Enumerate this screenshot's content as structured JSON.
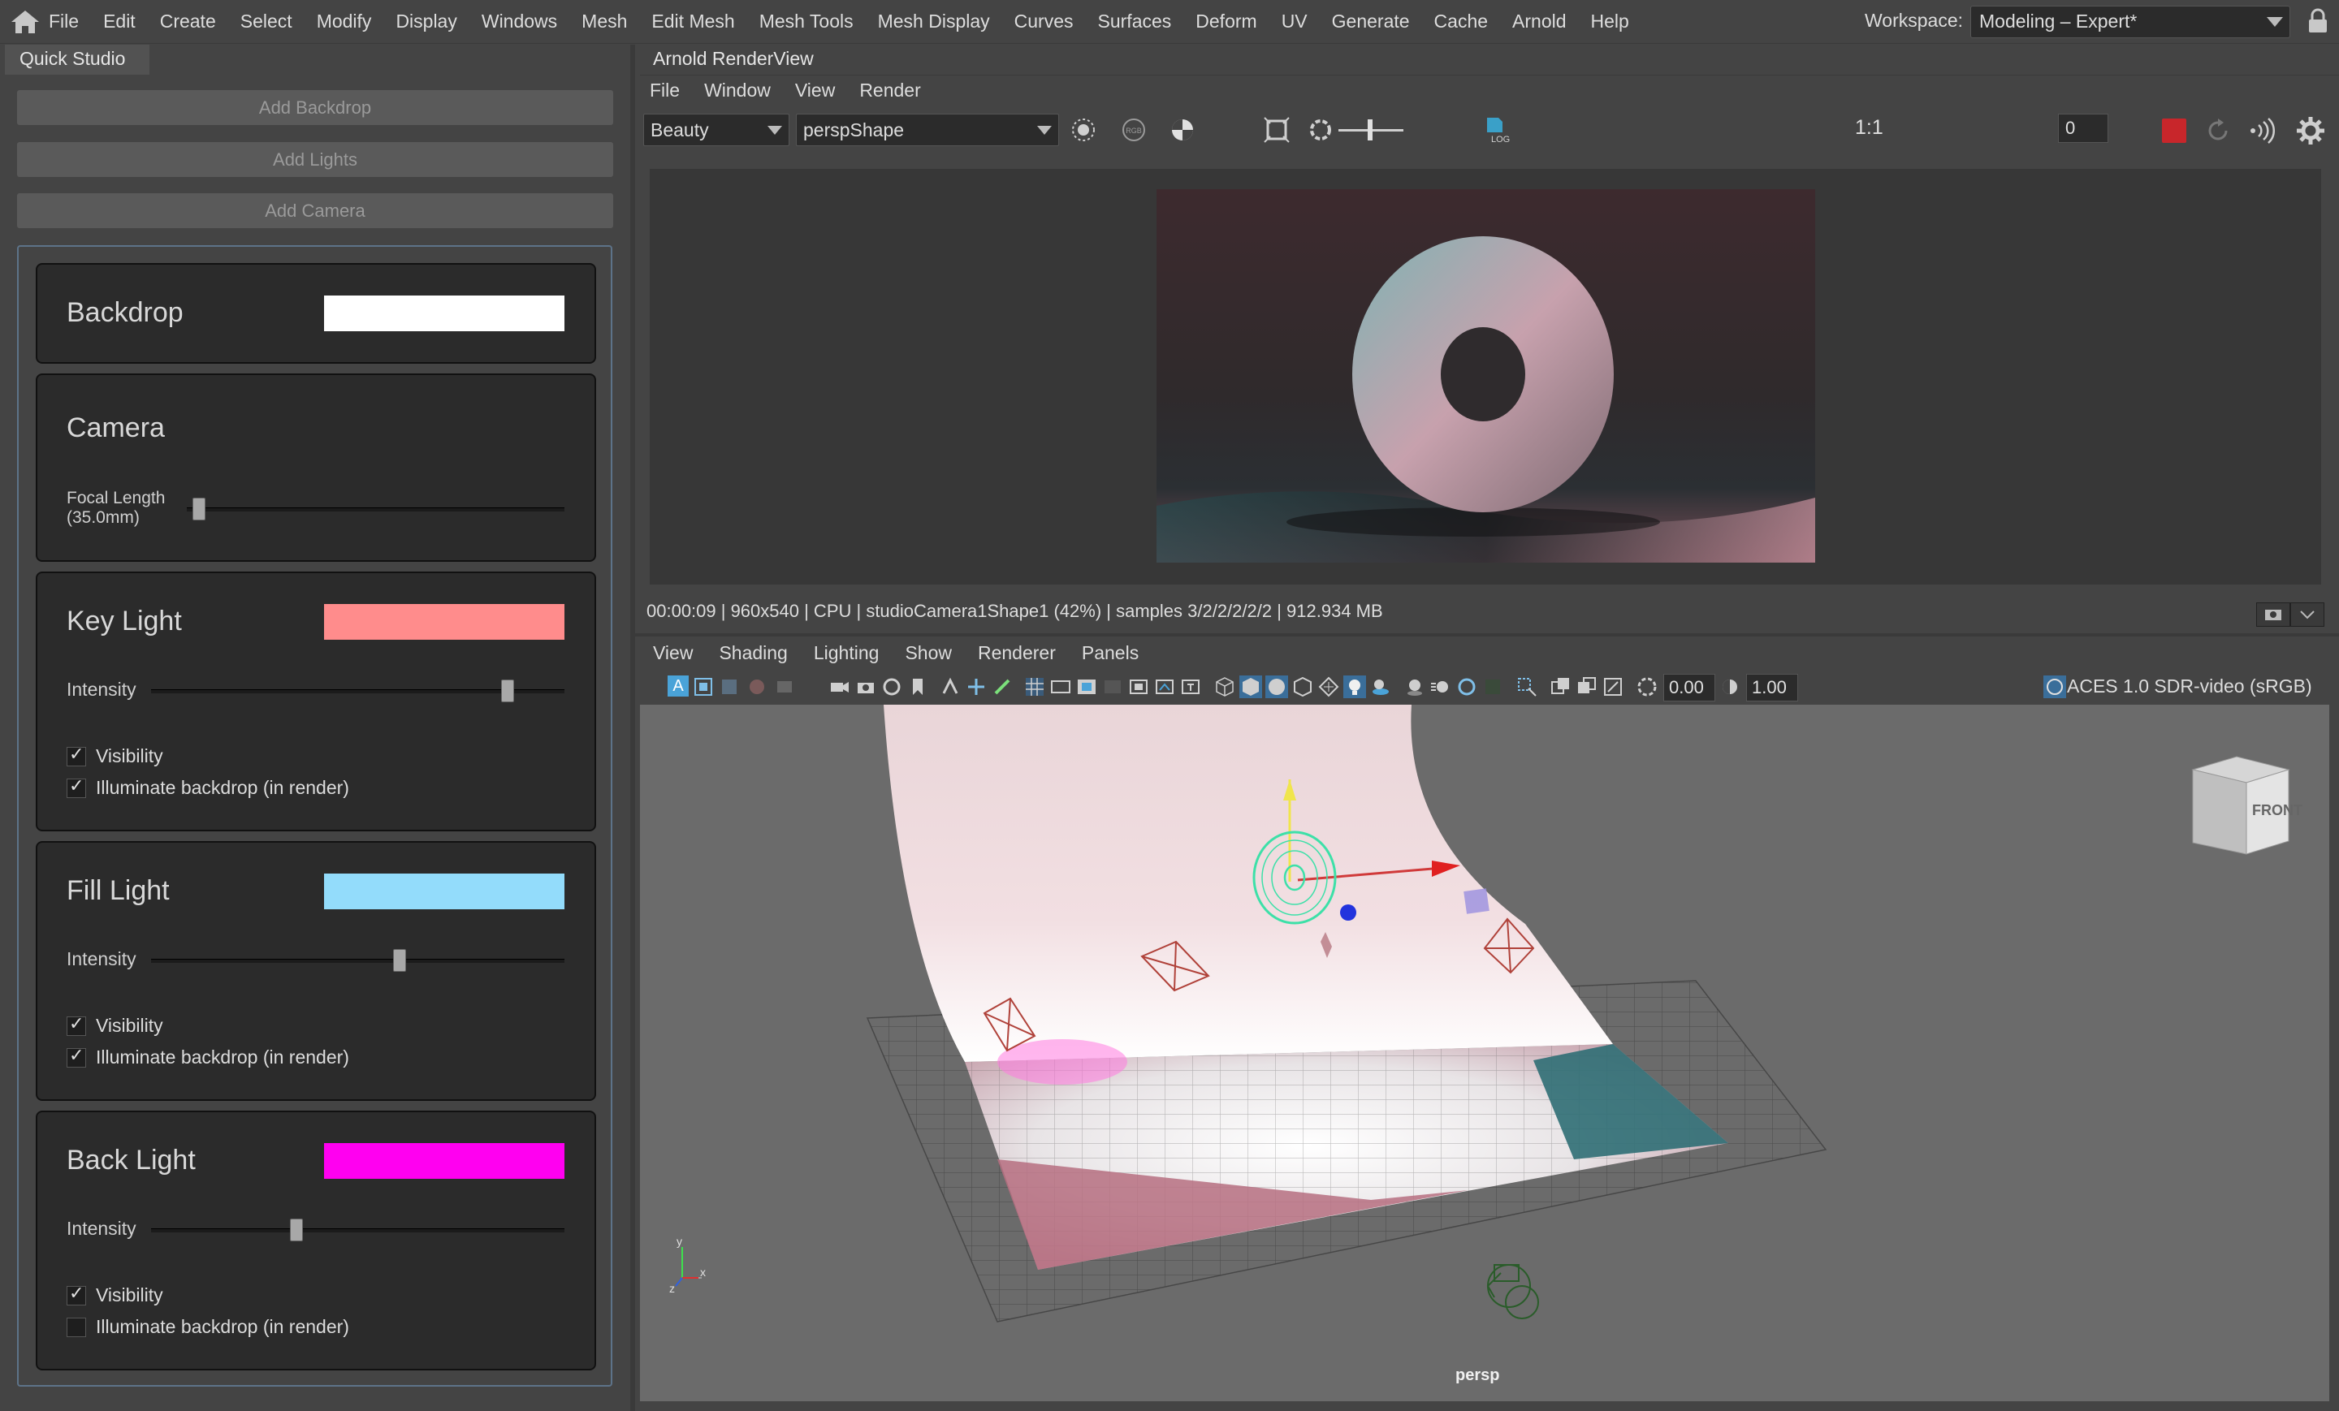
{
  "menubar": {
    "items": [
      "File",
      "Edit",
      "Create",
      "Select",
      "Modify",
      "Display",
      "Windows",
      "Mesh",
      "Edit Mesh",
      "Mesh Tools",
      "Mesh Display",
      "Curves",
      "Surfaces",
      "Deform",
      "UV",
      "Generate",
      "Cache",
      "Arnold",
      "Help"
    ],
    "workspace_label": "Workspace:",
    "workspace_value": "Modeling – Expert*"
  },
  "quick_studio": {
    "tab_label": "Quick Studio",
    "buttons": [
      "Add Backdrop",
      "Add Lights",
      "Add Camera"
    ],
    "backdrop": {
      "title": "Backdrop",
      "color": "#ffffff"
    },
    "camera": {
      "title": "Camera",
      "focal_label_line1": "Focal Length",
      "focal_label_line2": "(35.0mm)",
      "focal_value": 0.03
    },
    "key_light": {
      "title": "Key Light",
      "color": "#ff8c8c",
      "intensity_label": "Intensity",
      "intensity": 0.86,
      "visibility_label": "Visibility",
      "visibility": true,
      "illuminate_label": "Illuminate backdrop (in render)",
      "illuminate": true
    },
    "fill_light": {
      "title": "Fill Light",
      "color": "#93dcfb",
      "intensity_label": "Intensity",
      "intensity": 0.6,
      "visibility_label": "Visibility",
      "visibility": true,
      "illuminate_label": "Illuminate backdrop (in render)",
      "illuminate": true
    },
    "back_light": {
      "title": "Back Light",
      "color": "#ff00f0",
      "intensity_label": "Intensity",
      "intensity": 0.35,
      "visibility_label": "Visibility",
      "visibility": true,
      "illuminate_label": "Illuminate backdrop (in render)",
      "illuminate": false
    }
  },
  "render_view": {
    "tab_label": "Arnold RenderView",
    "menu": [
      "File",
      "Window",
      "View",
      "Render"
    ],
    "aov_value": "Beauty",
    "camera_value": "perspShape",
    "ratio_label": "1:1",
    "exposure_value": "0",
    "log_label": "LOG",
    "rgb_label": "RGB",
    "status": "00:00:09 |  960x540 | CPU | studioCamera1Shape1 (42%) | samples 3/2/2/2/2/2 | 912.934 MB"
  },
  "viewport": {
    "menu": [
      "View",
      "Shading",
      "Lighting",
      "Show",
      "Renderer",
      "Panels"
    ],
    "exposure": "0.00",
    "gamma": "1.00",
    "color_space": "ACES 1.0 SDR-video (sRGB)",
    "camera_label": "persp",
    "viewcube_label": "FRONT",
    "axis_y": "y",
    "axis_x": "x",
    "axis_z": "z"
  }
}
